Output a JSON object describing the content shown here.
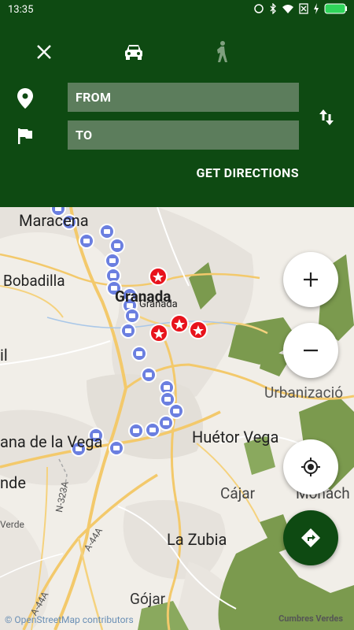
{
  "status_bar": {
    "time": "13:35"
  },
  "toolbar": {
    "close_icon": "close-icon",
    "car_icon": "car-icon",
    "walk_icon": "walk-icon"
  },
  "route": {
    "from_placeholder": "FROM",
    "to_placeholder": "TO",
    "get_directions_label": "GET DIRECTIONS"
  },
  "map": {
    "labels": {
      "maracena": "Maracena",
      "bobadilla": "Bobadilla",
      "granada_bold": "Granada",
      "granada_small": "Granada",
      "il": "il",
      "urbanizacion": "Urbanizació",
      "ana_de_la_vega": "ana de la Vega",
      "huetor_vega": "Huétor Vega",
      "cajar": "Cájar",
      "monach": "Monach",
      "nde": "nde",
      "verde": "Verde",
      "la_zubia": "La Zubia",
      "gojar": "Gójar",
      "road_n323a": "N-323A",
      "road_a44a_1": "A-44A",
      "road_a44a_2": "A-44A"
    },
    "attribution": "© OpenStreetMap contributors",
    "credit": "Cumbres Verdes"
  },
  "colors": {
    "primary": "#0e4a12",
    "field_bg": "#5c7d5c",
    "station_marker": "#6b7fe0",
    "poi_marker": "#e8131c"
  }
}
